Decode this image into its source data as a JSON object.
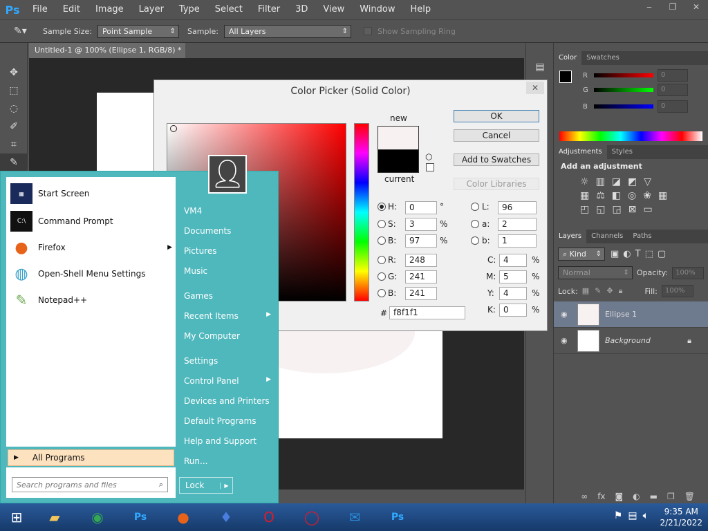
{
  "menubar": {
    "logo": "Ps",
    "items": [
      "File",
      "Edit",
      "Image",
      "Layer",
      "Type",
      "Select",
      "Filter",
      "3D",
      "View",
      "Window",
      "Help"
    ]
  },
  "options": {
    "sample_size_label": "Sample Size:",
    "sample_size_value": "Point Sample",
    "sample_label": "Sample:",
    "sample_value": "All Layers",
    "ring_label": "Show Sampling Ring"
  },
  "document": {
    "tab_title": "Untitled-1 @ 100% (Ellipse 1, RGB/8) *",
    "close": "×"
  },
  "color_panel": {
    "tabs": [
      "Color",
      "Swatches"
    ],
    "r_label": "R",
    "g_label": "G",
    "b_label": "B",
    "r_value": "0",
    "g_value": "0",
    "b_value": "0"
  },
  "adjustments_panel": {
    "tabs": [
      "Adjustments",
      "Styles"
    ],
    "heading": "Add an adjustment"
  },
  "layers_panel": {
    "tabs": [
      "Layers",
      "Channels",
      "Paths"
    ],
    "kind_label": "Kind",
    "blend_mode": "Normal",
    "opacity_label": "Opacity:",
    "opacity_value": "100%",
    "lock_label": "Lock:",
    "fill_label": "Fill:",
    "fill_value": "100%",
    "layers": [
      {
        "name": "Ellipse 1"
      },
      {
        "name": "Background"
      }
    ]
  },
  "color_picker": {
    "title": "Color Picker (Solid Color)",
    "new_label": "new",
    "current_label": "current",
    "ok": "OK",
    "cancel": "Cancel",
    "add_to_swatches": "Add to Swatches",
    "color_libraries": "Color Libraries",
    "h_label": "H:",
    "h_value": "0",
    "h_unit": "°",
    "s_label": "S:",
    "s_value": "3",
    "s_unit": "%",
    "b_label": "B:",
    "b_value": "97",
    "b_unit": "%",
    "r_label": "R:",
    "r_value": "248",
    "g_label": "G:",
    "g_value": "241",
    "bb_label": "B:",
    "bb_value": "241",
    "l_label": "L:",
    "l_value": "96",
    "a_label": "a:",
    "a_value": "2",
    "lb_label": "b:",
    "lb_value": "1",
    "c_label": "C:",
    "c_value": "4",
    "c_unit": "%",
    "m_label": "M:",
    "m_value": "5",
    "m_unit": "%",
    "y_label": "Y:",
    "y_value": "4",
    "y_unit": "%",
    "k_label": "K:",
    "k_value": "0",
    "k_unit": "%",
    "hex_label": "#",
    "hex_value": "f8f1f1",
    "new_color": "#f8f1f1",
    "current_color": "#000000"
  },
  "start_menu": {
    "left_items": [
      {
        "label": "Start Screen"
      },
      {
        "label": "Command Prompt"
      },
      {
        "label": "Firefox"
      },
      {
        "label": "Open-Shell Menu Settings"
      },
      {
        "label": "Notepad++"
      }
    ],
    "all_programs": "All Programs",
    "search_placeholder": "Search programs and files",
    "right_items": [
      {
        "label": "VM4"
      },
      {
        "label": "Documents"
      },
      {
        "label": "Pictures"
      },
      {
        "label": "Music"
      },
      {
        "label": "Games"
      },
      {
        "label": "Recent Items"
      },
      {
        "label": "My Computer"
      },
      {
        "label": "Settings"
      },
      {
        "label": "Control Panel"
      },
      {
        "label": "Devices and Printers"
      },
      {
        "label": "Default Programs"
      },
      {
        "label": "Help and Support"
      },
      {
        "label": "Run..."
      }
    ],
    "lock": "Lock"
  },
  "taskbar": {
    "time": "9:35 AM",
    "date": "2/21/2022"
  }
}
